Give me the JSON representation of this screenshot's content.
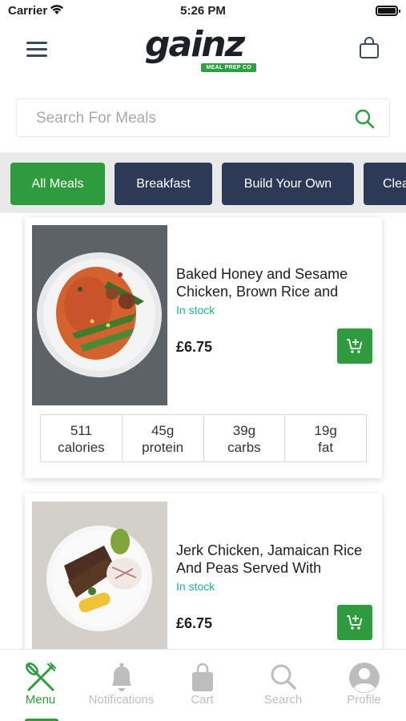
{
  "status_bar": {
    "carrier": "Carrier",
    "time": "5:26 PM"
  },
  "header": {
    "logo_text": "gainz",
    "logo_subtext": "MEAL PREP CO"
  },
  "search": {
    "placeholder": "Search For Meals"
  },
  "categories": [
    {
      "label": "All Meals",
      "active": true
    },
    {
      "label": "Breakfast",
      "active": false
    },
    {
      "label": "Build Your Own",
      "active": false
    },
    {
      "label": "Clean",
      "active": false
    }
  ],
  "meals": [
    {
      "title": "Baked Honey and Sesame Chicken, Brown Rice and",
      "stock": "In stock",
      "price": "£6.75",
      "macros": [
        {
          "value": "511",
          "unit": "calories"
        },
        {
          "value": "45g",
          "unit": "protein"
        },
        {
          "value": "39g",
          "unit": "carbs"
        },
        {
          "value": "19g",
          "unit": "fat"
        }
      ]
    },
    {
      "title": "Jerk Chicken, Jamaican Rice And Peas Served With",
      "stock": "In stock",
      "price": "£6.75",
      "macros": [
        {
          "value": "",
          "unit": ""
        },
        {
          "value": "",
          "unit": ""
        },
        {
          "value": "",
          "unit": ""
        },
        {
          "value": "",
          "unit": ""
        }
      ]
    }
  ],
  "tabs": [
    {
      "label": "Menu",
      "icon": "cutlery-icon",
      "active": true
    },
    {
      "label": "Notifications",
      "icon": "bell-icon",
      "active": false
    },
    {
      "label": "Cart",
      "icon": "shopping-bag-icon",
      "active": false
    },
    {
      "label": "Search",
      "icon": "search-icon",
      "active": false
    },
    {
      "label": "Profile",
      "icon": "profile-icon",
      "active": false
    }
  ],
  "colors": {
    "brand_green": "#2e9b3e",
    "navy": "#2c3a57",
    "stock_teal": "#1fb38a",
    "inactive_gray": "#bdbdbd"
  }
}
